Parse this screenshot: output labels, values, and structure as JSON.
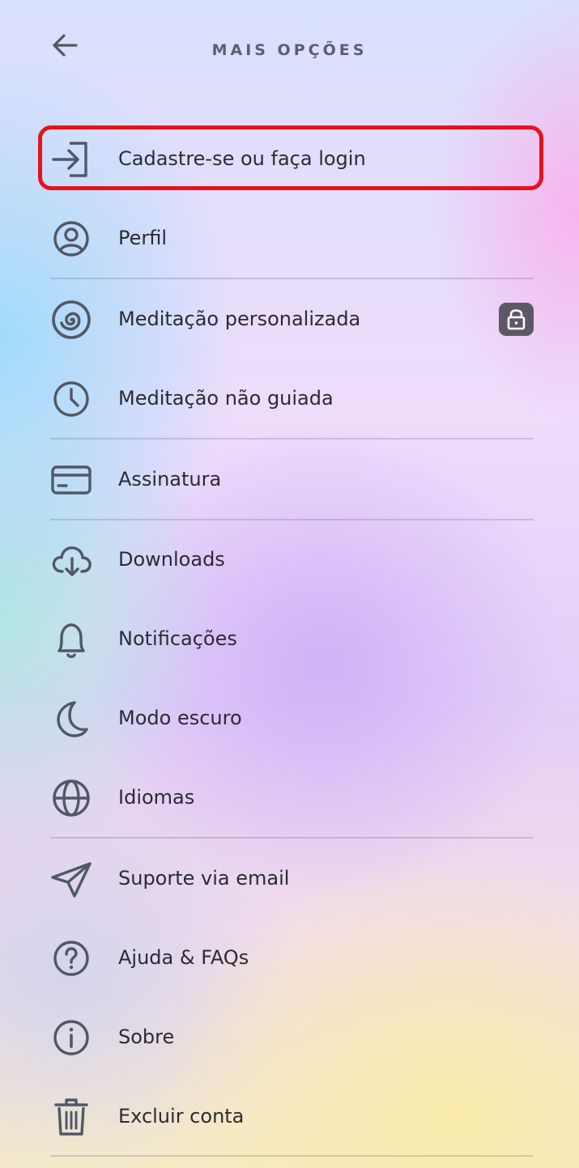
{
  "header": {
    "title": "MAIS OPÇÕES",
    "back_icon": "arrow-left-icon"
  },
  "menu": {
    "items": [
      {
        "label": "Cadastre-se ou faça login",
        "icon": "login-icon",
        "highlighted": true
      },
      {
        "label": "Perfil",
        "icon": "profile-icon"
      },
      {
        "label": "Meditação personalizada",
        "icon": "spiral-icon",
        "locked": true
      },
      {
        "label": "Meditação não guiada",
        "icon": "clock-icon"
      },
      {
        "label": "Assinatura",
        "icon": "credit-card-icon"
      },
      {
        "label": "Downloads",
        "icon": "cloud-download-icon"
      },
      {
        "label": "Notificações",
        "icon": "bell-icon"
      },
      {
        "label": "Modo escuro",
        "icon": "moon-icon"
      },
      {
        "label": "Idiomas",
        "icon": "globe-icon"
      },
      {
        "label": "Suporte via email",
        "icon": "paper-plane-icon"
      },
      {
        "label": "Ajuda & FAQs",
        "icon": "help-circle-icon"
      },
      {
        "label": "Sobre",
        "icon": "info-circle-icon"
      },
      {
        "label": "Excluir conta",
        "icon": "trash-icon"
      }
    ]
  },
  "colors": {
    "highlight": "#e5121d",
    "icon_stroke": "#515865",
    "lock_badge": "#5d5865"
  }
}
